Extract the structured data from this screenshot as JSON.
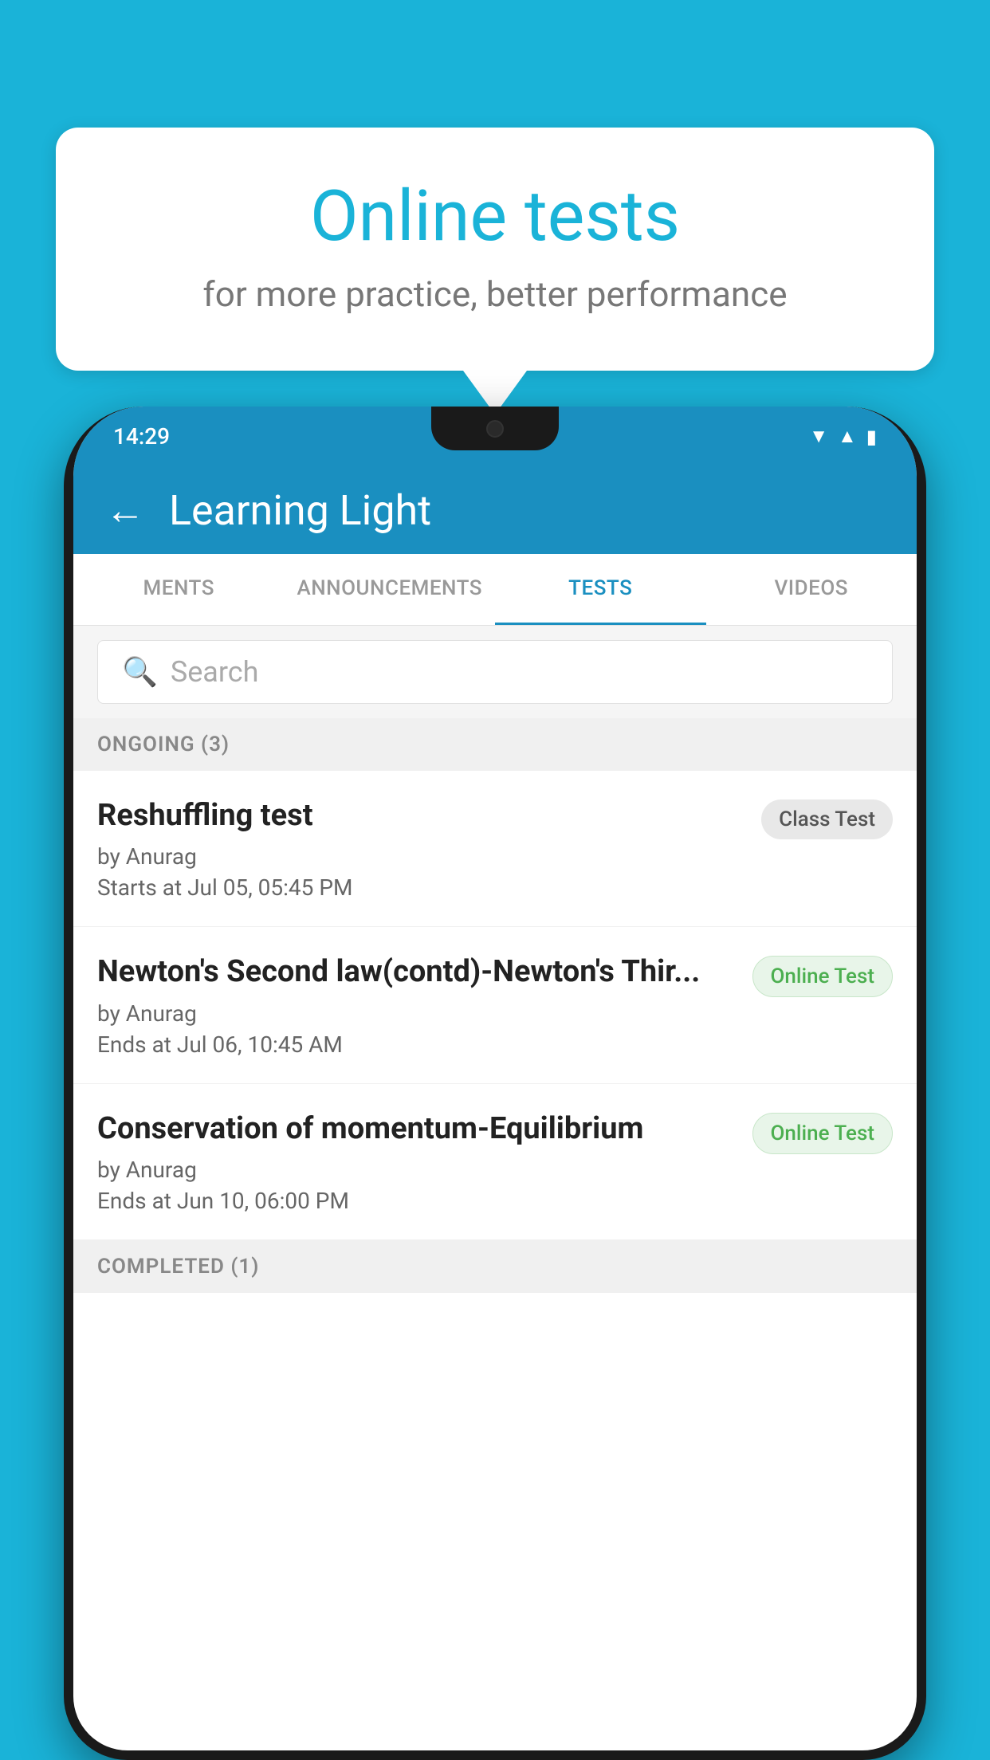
{
  "background_color": "#1ab3d8",
  "speech_bubble": {
    "title": "Online tests",
    "subtitle": "for more practice, better performance"
  },
  "phone": {
    "status_bar": {
      "time": "14:29",
      "icons": [
        "wifi",
        "signal",
        "battery"
      ]
    },
    "header": {
      "title": "Learning Light",
      "back_label": "←"
    },
    "tabs": [
      {
        "label": "MENTS",
        "active": false
      },
      {
        "label": "ANNOUNCEMENTS",
        "active": false
      },
      {
        "label": "TESTS",
        "active": true
      },
      {
        "label": "VIDEOS",
        "active": false
      }
    ],
    "search": {
      "placeholder": "Search"
    },
    "sections": [
      {
        "title": "ONGOING (3)",
        "tests": [
          {
            "name": "Reshuffling test",
            "author": "by Anurag",
            "date": "Starts at  Jul 05, 05:45 PM",
            "badge": "Class Test",
            "badge_type": "class"
          },
          {
            "name": "Newton's Second law(contd)-Newton's Thir...",
            "author": "by Anurag",
            "date": "Ends at  Jul 06, 10:45 AM",
            "badge": "Online Test",
            "badge_type": "online"
          },
          {
            "name": "Conservation of momentum-Equilibrium",
            "author": "by Anurag",
            "date": "Ends at  Jun 10, 06:00 PM",
            "badge": "Online Test",
            "badge_type": "online"
          }
        ]
      },
      {
        "title": "COMPLETED (1)",
        "tests": []
      }
    ]
  }
}
